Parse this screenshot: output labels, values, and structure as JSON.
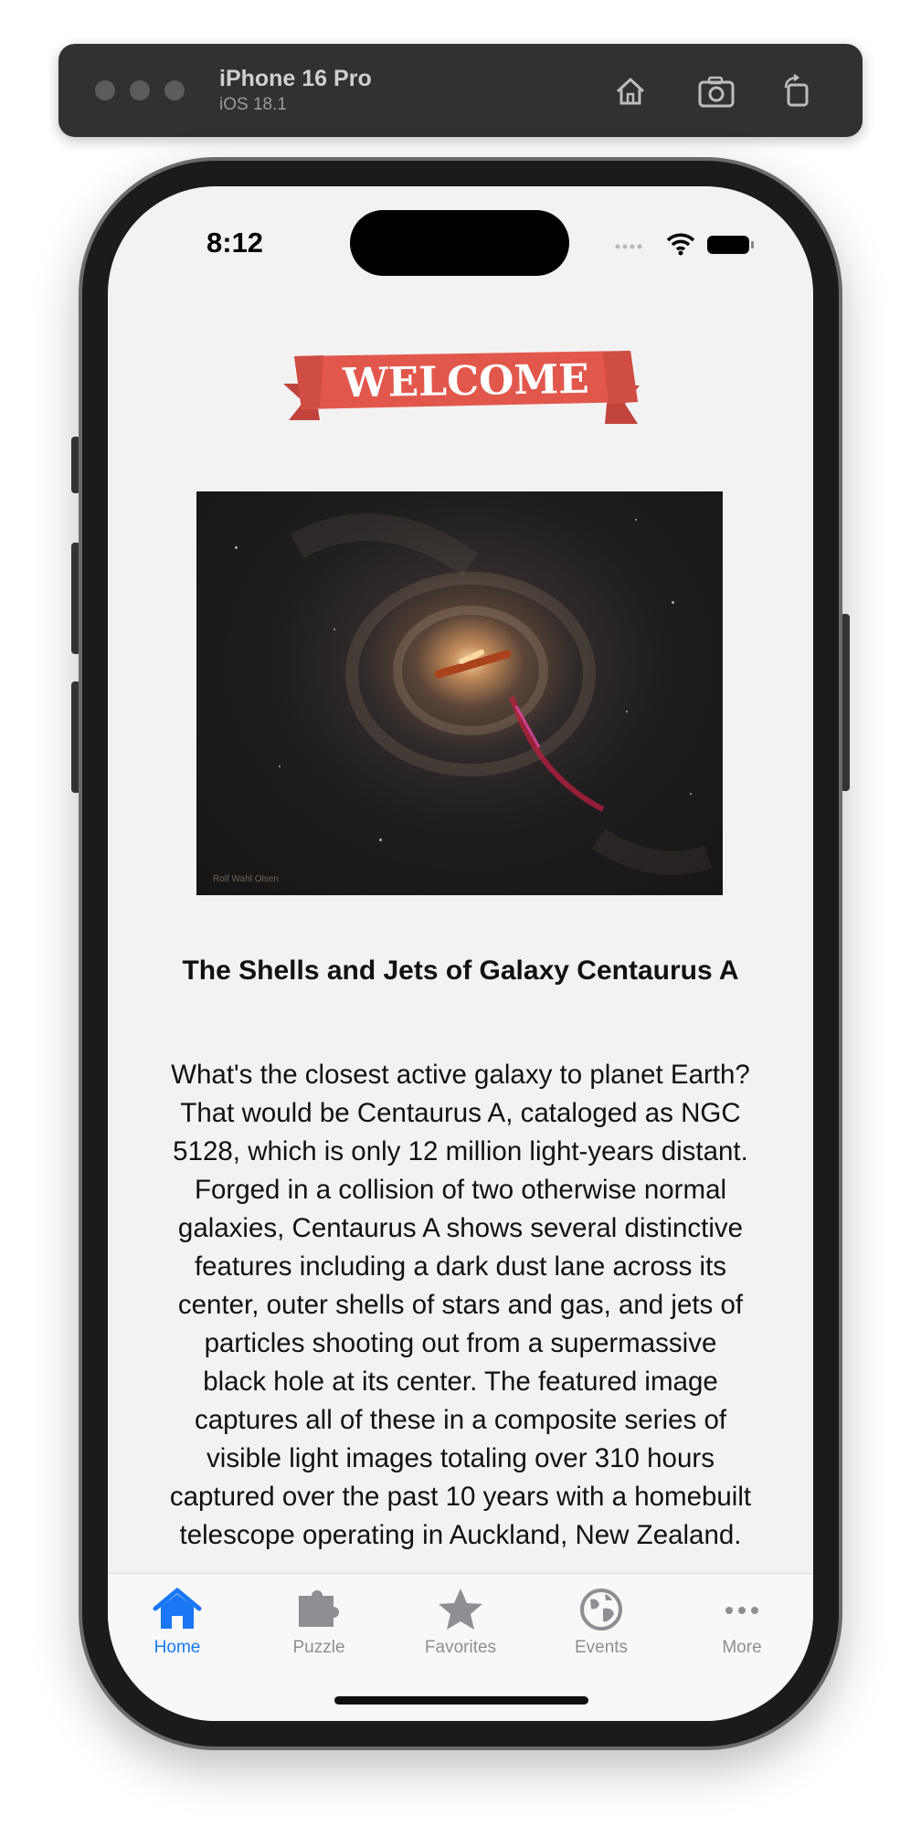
{
  "simulator": {
    "device_name": "iPhone 16 Pro",
    "os_version": "iOS 18.1",
    "icons": [
      "home-icon",
      "screenshot-icon",
      "rotate-icon"
    ]
  },
  "status_bar": {
    "time": "8:12",
    "icons": [
      "cellular-icon",
      "wifi-icon",
      "battery-icon"
    ]
  },
  "banner": {
    "text": "WELCOME",
    "color": "#e2574c"
  },
  "article": {
    "image_credit": "Rolf Wahl Olsen",
    "title": "The Shells and Jets of Galaxy Centaurus A",
    "body": "What's the closest active galaxy to planet Earth?\nThat would be Centaurus A, cataloged as NGC\n5128, which is only 12 million light-years distant.\nForged in a collision of two otherwise normal\ngalaxies, Centaurus A shows several distinctive\nfeatures including a dark dust lane across its\ncenter, outer shells of stars and gas, and jets of\nparticles shooting out from a supermassive\nblack hole at its center.  The featured image\ncaptures all of these in a composite series of\nvisible light images totaling over 310 hours\ncaptured over the past 10 years with a homebuilt\ntelescope operating in Auckland, New Zealand."
  },
  "tab_bar": {
    "active_color": "#1977f3",
    "inactive_color": "#8e8e93",
    "tabs": [
      {
        "label": "Home",
        "icon": "house-icon",
        "active": true
      },
      {
        "label": "Puzzle",
        "icon": "puzzle-piece-icon",
        "active": false
      },
      {
        "label": "Favorites",
        "icon": "star-icon",
        "active": false
      },
      {
        "label": "Events",
        "icon": "globe-icon",
        "active": false
      },
      {
        "label": "More",
        "icon": "ellipsis-icon",
        "active": false
      }
    ]
  }
}
